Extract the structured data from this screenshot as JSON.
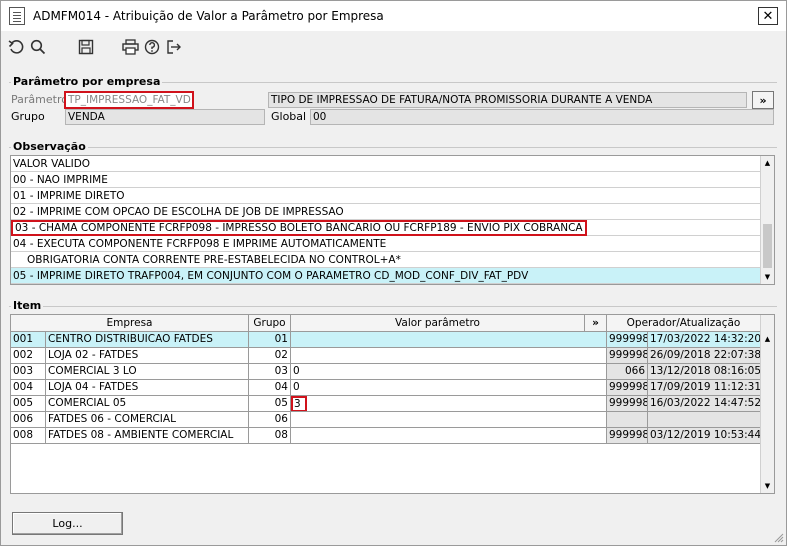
{
  "window": {
    "title": "ADMFM014 - Atribuição de Valor a Parâmetro por Empresa",
    "close_label": "✕"
  },
  "toolbar": {
    "icons": [
      "undo-icon",
      "search-icon",
      "save-icon",
      "print-icon",
      "help-icon",
      "exit-icon"
    ]
  },
  "param_section": {
    "title": "Parâmetro por empresa",
    "param_label": "Parâmetro",
    "param_value": "TP_IMPRESSAO_FAT_VD",
    "param_desc": "TIPO DE IMPRESSAO DE FATURA/NOTA PROMISSORIA DURANTE A VENDA",
    "more_label": "»",
    "group_label": "Grupo",
    "group_value": "VENDA",
    "global_label": "Global",
    "global_value": "00"
  },
  "obs_section": {
    "title": "Observação",
    "rows": [
      "VALOR VALIDO",
      "00 - NAO IMPRIME",
      "01 - IMPRIME DIRETO",
      "02 - IMPRIME COM OPCAO DE ESCOLHA DE JOB DE IMPRESSAO",
      "03 - CHAMA COMPONENTE FCRFP098 - IMPRESSO BOLETO BANCARIO OU FCRFP189 - ENVIO PIX COBRANCA",
      "04 - EXECUTA COMPONENTE FCRFP098 E IMPRIME AUTOMATICAMENTE",
      "   OBRIGATORIA CONTA CORRENTE PRE-ESTABELECIDA NO CONTROL+A*",
      "05 - IMPRIME DIRETO TRAFP004, EM CONJUNTO COM O PARAMETRO CD_MOD_CONF_DIV_FAT_PDV"
    ]
  },
  "item_section": {
    "title": "Item",
    "headers": {
      "empresa": "Empresa",
      "grupo": "Grupo",
      "valor": "Valor parâmetro",
      "more": "»",
      "operador": "Operador/Atualização"
    },
    "rows": [
      {
        "code": "001",
        "name": "CENTRO DISTRIBUICAO FATDES",
        "grupo": "01",
        "valor": "",
        "operador": "999998",
        "data": "17/03/2022 14:32:20"
      },
      {
        "code": "002",
        "name": "LOJA 02 - FATDES",
        "grupo": "02",
        "valor": "",
        "operador": "999998",
        "data": "26/09/2018 22:07:38"
      },
      {
        "code": "003",
        "name": "COMERCIAL 3 LO",
        "grupo": "03",
        "valor": "0",
        "operador": "066",
        "data": "13/12/2018 08:16:05"
      },
      {
        "code": "004",
        "name": "LOJA 04 - FATDES",
        "grupo": "04",
        "valor": "0",
        "operador": "999998",
        "data": "17/09/2019 11:12:31"
      },
      {
        "code": "005",
        "name": "COMERCIAL 05",
        "grupo": "05",
        "valor": "3",
        "operador": "999998",
        "data": "16/03/2022 14:47:52"
      },
      {
        "code": "006",
        "name": "FATDES 06 - COMERCIAL",
        "grupo": "06",
        "valor": "",
        "operador": "",
        "data": ""
      },
      {
        "code": "008",
        "name": "FATDES 08 - AMBIENTE COMERCIAL",
        "grupo": "08",
        "valor": "",
        "operador": "999998",
        "data": "03/12/2019 10:53:44"
      }
    ]
  },
  "log_button": "Log..."
}
